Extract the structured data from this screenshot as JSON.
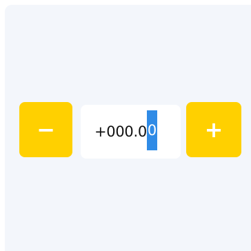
{
  "stepper": {
    "decrement_label": "−",
    "increment_label": "+",
    "value_prefix": "+000.0",
    "value_selected": "0",
    "value_full": "+000.00"
  },
  "colors": {
    "accent": "#ffd000",
    "selection": "#2f8be6",
    "panel_bg": "#f3f6fb",
    "field_bg": "#ffffff"
  }
}
